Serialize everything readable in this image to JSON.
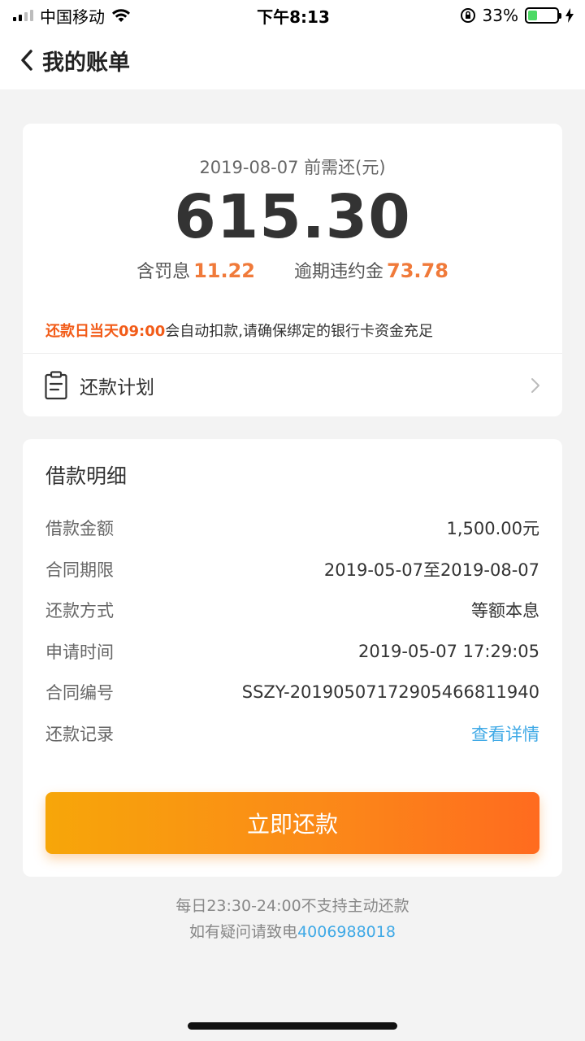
{
  "status_bar": {
    "carrier": "中国移动",
    "time": "下午8:13",
    "battery_percent": "33%",
    "battery_level": 0.33
  },
  "nav": {
    "title": "我的账单"
  },
  "summary": {
    "due_label": "2019-08-07 前需还(元)",
    "due_amount": "615.30",
    "penalty_interest_label": "含罚息",
    "penalty_interest_value": "11.22",
    "overdue_fee_label": "逾期违约金",
    "overdue_fee_value": "73.78",
    "notice_highlight": "还款日当天09:00",
    "notice_text": "会自动扣款,请确保绑定的银行卡资金充足",
    "plan_label": "还款计划"
  },
  "detail": {
    "title": "借款明细",
    "rows": [
      {
        "label": "借款金额",
        "value": "1,500.00元"
      },
      {
        "label": "合同期限",
        "value": "2019-05-07至2019-08-07"
      },
      {
        "label": "还款方式",
        "value": "等额本息"
      },
      {
        "label": "申请时间",
        "value": "2019-05-07 17:29:05"
      },
      {
        "label": "合同编号",
        "value": "SSZY-20190507172905466811940"
      },
      {
        "label": "还款记录",
        "value": "查看详情"
      }
    ],
    "pay_button_label": "立即还款"
  },
  "footer": {
    "line1": "每日23:30-24:00不支持主动还款",
    "line2_prefix": "如有疑问请致电",
    "phone": "4006988018"
  },
  "colors": {
    "accent_orange": "#f07a3a",
    "notice_orange": "#f25c19",
    "link_blue": "#3fa9e6",
    "button_gradient_start": "#f7a609",
    "button_gradient_end": "#ff6b1f"
  }
}
